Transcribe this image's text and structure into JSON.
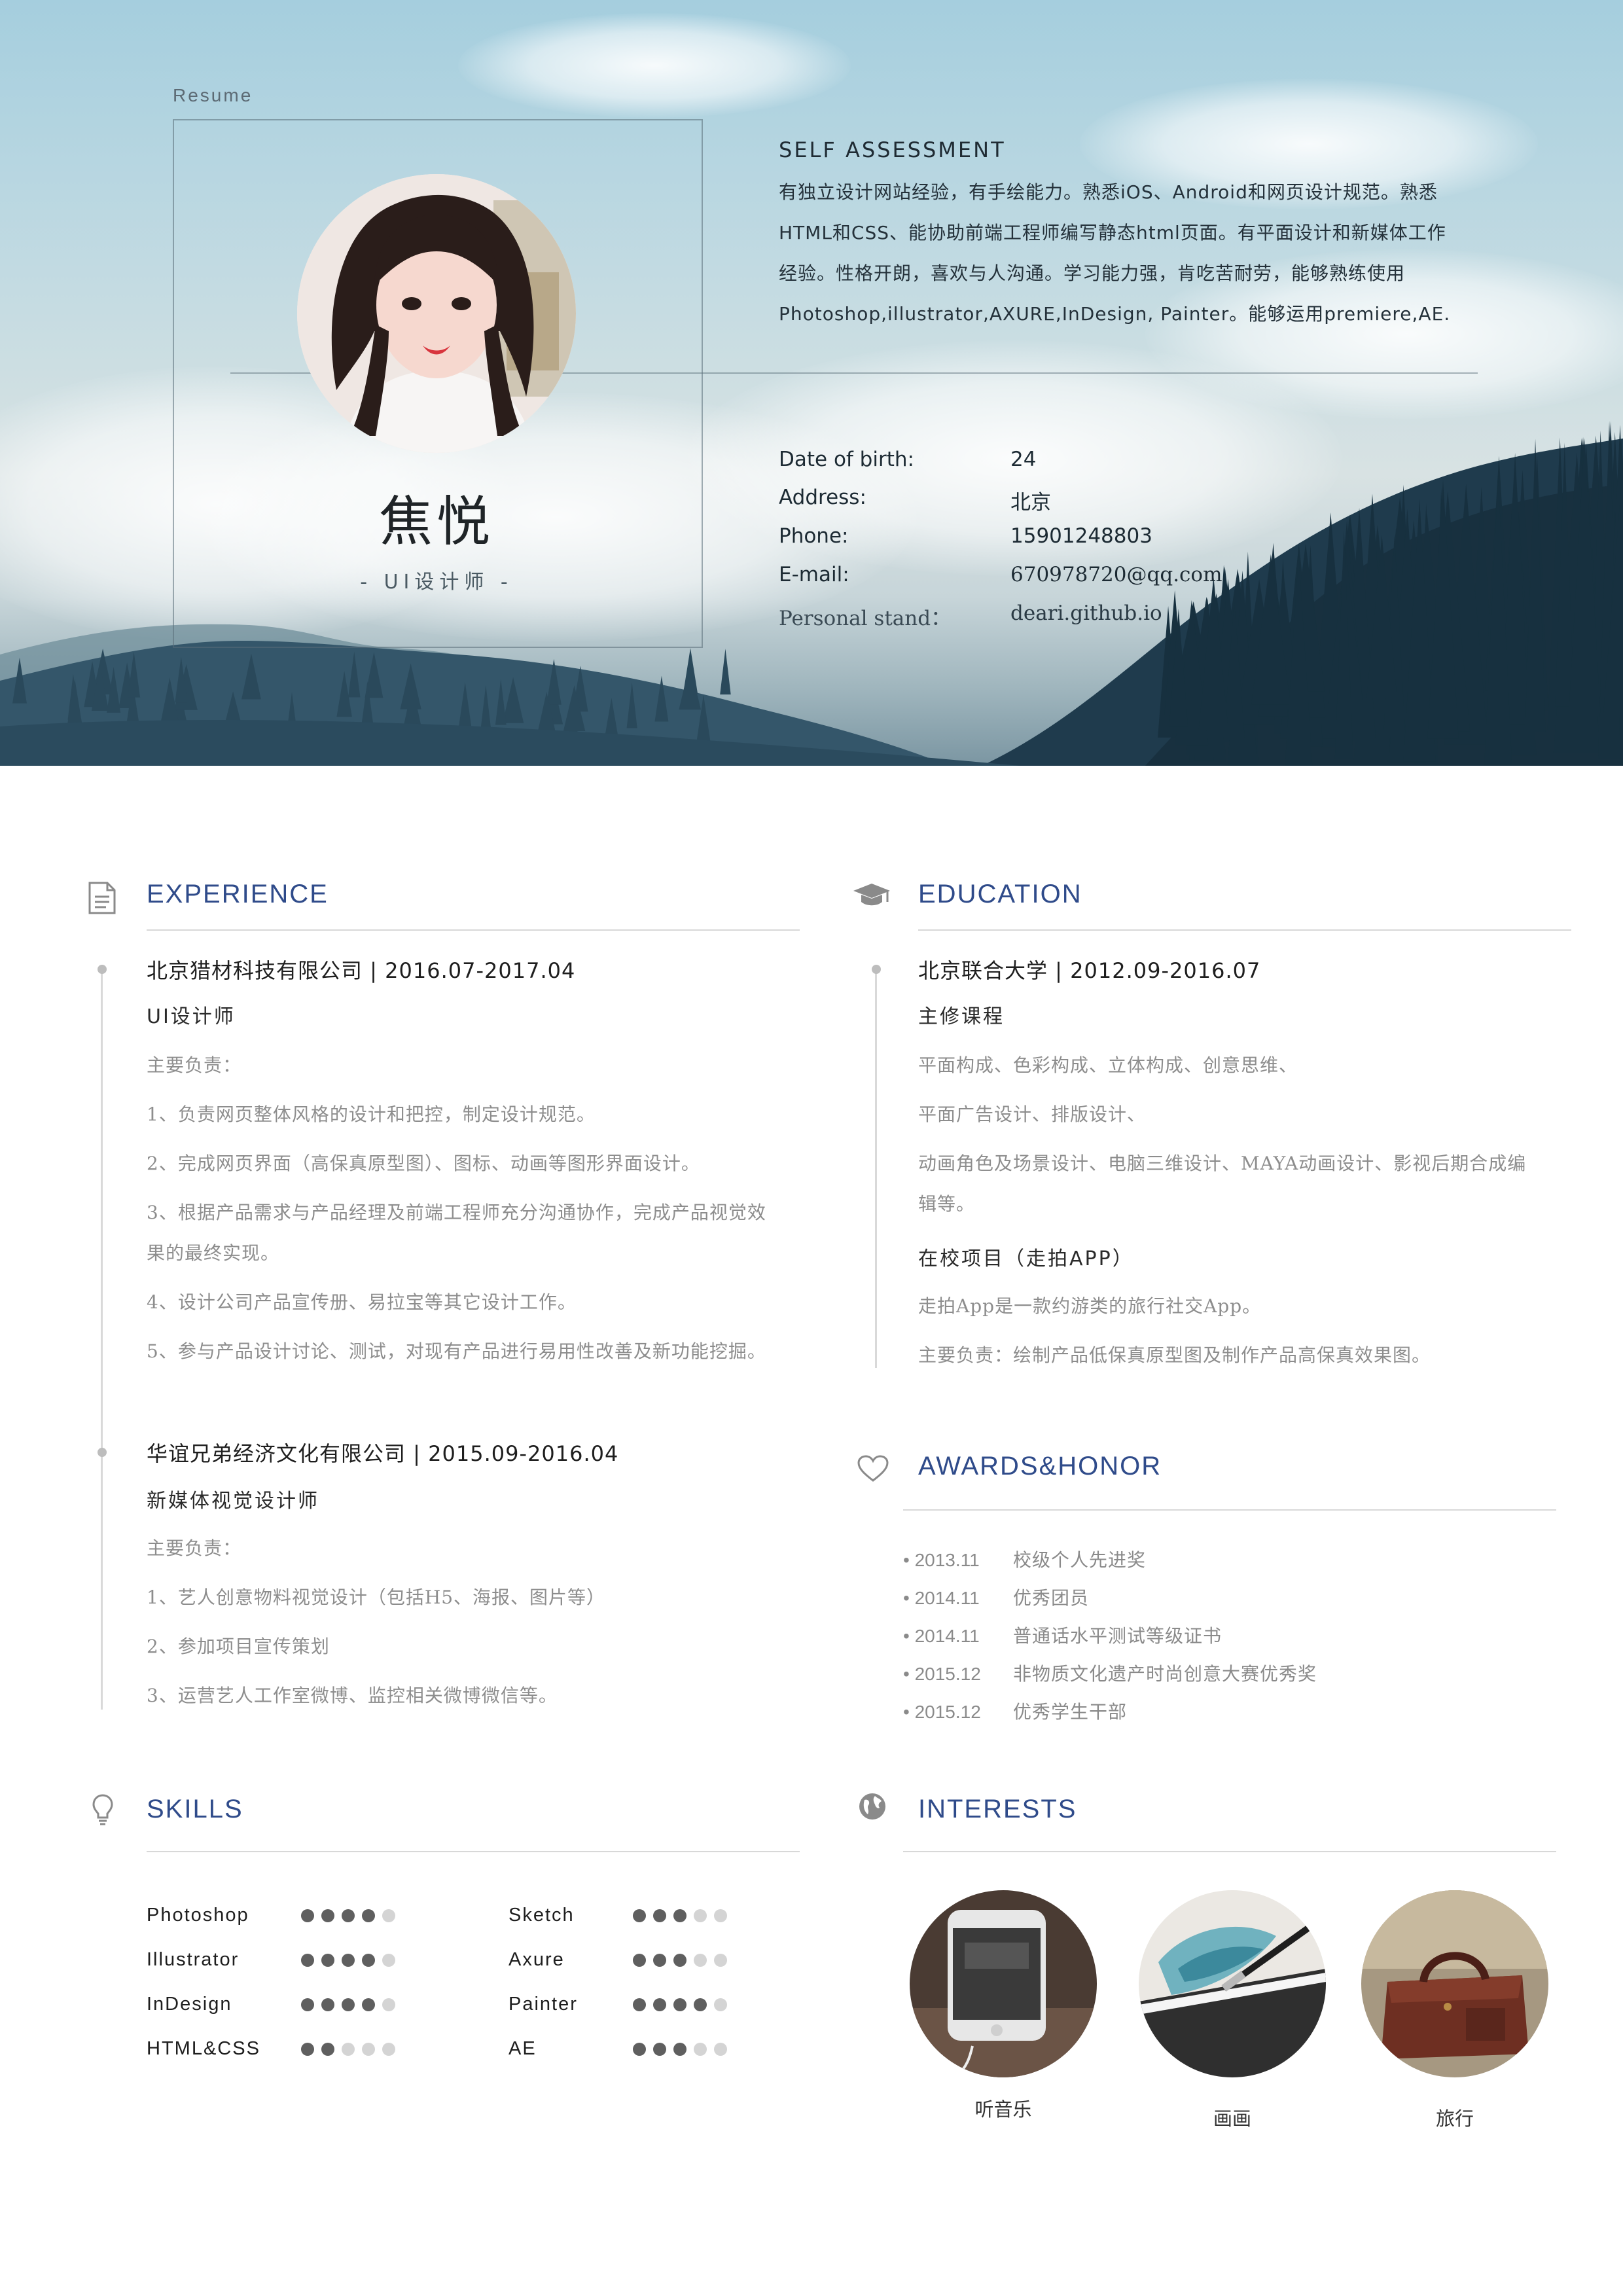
{
  "hero": {
    "resume_label": "Resume",
    "name": "焦悦",
    "role": "- UI设计师 -",
    "self_assessment": {
      "title": "SELF ASSESSMENT",
      "lines": [
        "有独立设计网站经验，有手绘能力。熟悉iOS、Android和网页设计规范。熟悉",
        "HTML和CSS、能协助前端工程师编写静态html页面。有平面设计和新媒体工作",
        "经验。性格开朗，喜欢与人沟通。学习能力强，肯吃苦耐劳，能够熟练使用",
        "Photoshop,illustrator,AXURE,InDesign, Painter。能够运用premiere,AE."
      ]
    },
    "info": [
      {
        "key": "Date of birth:",
        "value": "24"
      },
      {
        "key": "Address:",
        "value": "北京"
      },
      {
        "key": "Phone:",
        "value": "15901248803"
      },
      {
        "key": "E-mail:",
        "value": "670978720@qq.com"
      },
      {
        "key": "Personal stand：",
        "value": "deari.github.io"
      }
    ]
  },
  "experience": {
    "title": "EXPERIENCE",
    "jobs": [
      {
        "company": "北京猎材科技有限公司 | 2016.07-2017.04",
        "role": "UI设计师",
        "lines": [
          "主要负责：",
          "1、负责网页整体风格的设计和把控，制定设计规范。",
          "2、完成网页界面（高保真原型图）、图标、动画等图形界面设计。",
          "3、根据产品需求与产品经理及前端工程师充分沟通协作，完成产品视觉效",
          "果的最终实现。",
          "4、设计公司产品宣传册、易拉宝等其它设计工作。",
          "5、参与产品设计讨论、测试，对现有产品进行易用性改善及新功能挖掘。"
        ]
      },
      {
        "company": "华谊兄弟经济文化有限公司 | 2015.09-2016.04",
        "role": "新媒体视觉设计师",
        "lines": [
          "主要负责：",
          "1、艺人创意物料视觉设计（包括H5、海报、图片等）",
          "2、参加项目宣传策划",
          "3、运营艺人工作室微博、监控相关微博微信等。"
        ]
      }
    ]
  },
  "education": {
    "title": "EDUCATION",
    "school": "北京联合大学 | 2012.09-2016.07",
    "courses_title": "主修课程",
    "courses": [
      "平面构成、色彩构成、立体构成、创意思维、",
      "平面广告设计、排版设计、",
      "动画角色及场景设计、电脑三维设计、MAYA动画设计、影视后期合成编",
      "辑等。"
    ],
    "project_title": "在校项目（走拍APP）",
    "project_lines": [
      "走拍App是一款约游类的旅行社交App。",
      "主要负责：绘制产品低保真原型图及制作产品高保真效果图。"
    ]
  },
  "awards": {
    "title": "AWARDS&HONOR",
    "items": [
      {
        "date": "• 2013.11",
        "text": "校级个人先进奖"
      },
      {
        "date": "• 2014.11",
        "text": "优秀团员"
      },
      {
        "date": "• 2014.11",
        "text": "普通话水平测试等级证书"
      },
      {
        "date": "• 2015.12",
        "text": "非物质文化遗产时尚创意大赛优秀奖"
      },
      {
        "date": "• 2015.12",
        "text": "优秀学生干部"
      }
    ]
  },
  "skills": {
    "title": "SKILLS",
    "max": 5,
    "items": [
      {
        "name": "Photoshop",
        "level": 4
      },
      {
        "name": "Illustrator",
        "level": 4
      },
      {
        "name": "InDesign",
        "level": 4
      },
      {
        "name": "HTML&CSS",
        "level": 2
      },
      {
        "name": "Sketch",
        "level": 3
      },
      {
        "name": "Axure",
        "level": 3
      },
      {
        "name": "Painter",
        "level": 4
      },
      {
        "name": "AE",
        "level": 3
      }
    ],
    "filled_color": "#5f5f5f",
    "empty_color": "#d4d4d4"
  },
  "interests": {
    "title": "INTERESTS",
    "items": [
      {
        "label": "听音乐",
        "icon": "phone-music-photo"
      },
      {
        "label": "画画",
        "icon": "brush-painting-photo"
      },
      {
        "label": "旅行",
        "icon": "travel-bag-photo"
      }
    ]
  },
  "colors": {
    "accent": "#2f4b8a",
    "rule": "#d8d8d8",
    "muted_text": "#8d8d8d"
  }
}
